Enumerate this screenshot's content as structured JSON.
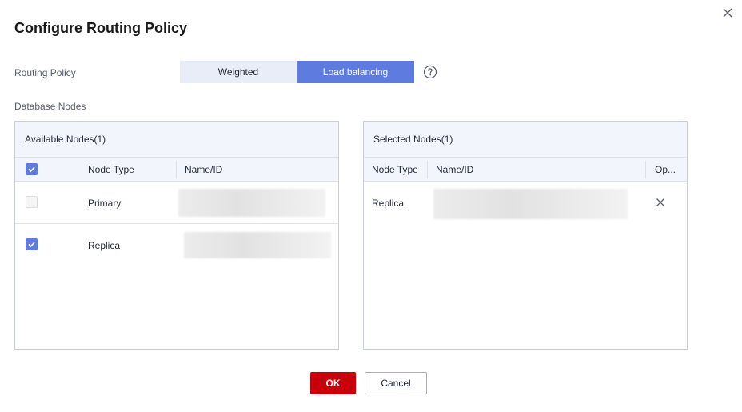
{
  "dialog": {
    "title": "Configure Routing Policy"
  },
  "routing": {
    "label": "Routing Policy",
    "options": [
      "Weighted",
      "Load balancing"
    ],
    "selected": "Load balancing"
  },
  "database_nodes": {
    "label": "Database Nodes"
  },
  "available": {
    "header": "Available Nodes(1)",
    "columns": [
      "Node Type",
      "Name/ID"
    ],
    "rows": [
      {
        "node_type": "Primary",
        "checked": false,
        "disabled": true
      },
      {
        "node_type": "Replica",
        "checked": true,
        "disabled": false
      }
    ]
  },
  "selected_panel": {
    "header": "Selected Nodes(1)",
    "columns": [
      "Node Type",
      "Name/ID",
      "Op..."
    ],
    "rows": [
      {
        "node_type": "Replica"
      }
    ]
  },
  "buttons": {
    "ok": "OK",
    "cancel": "Cancel"
  },
  "colors": {
    "accent": "#5e7ce0",
    "primary_button": "#c7000b",
    "segment_inactive": "#e9edf7"
  },
  "icons": [
    "close-icon",
    "help-icon",
    "check-icon",
    "remove-icon"
  ]
}
